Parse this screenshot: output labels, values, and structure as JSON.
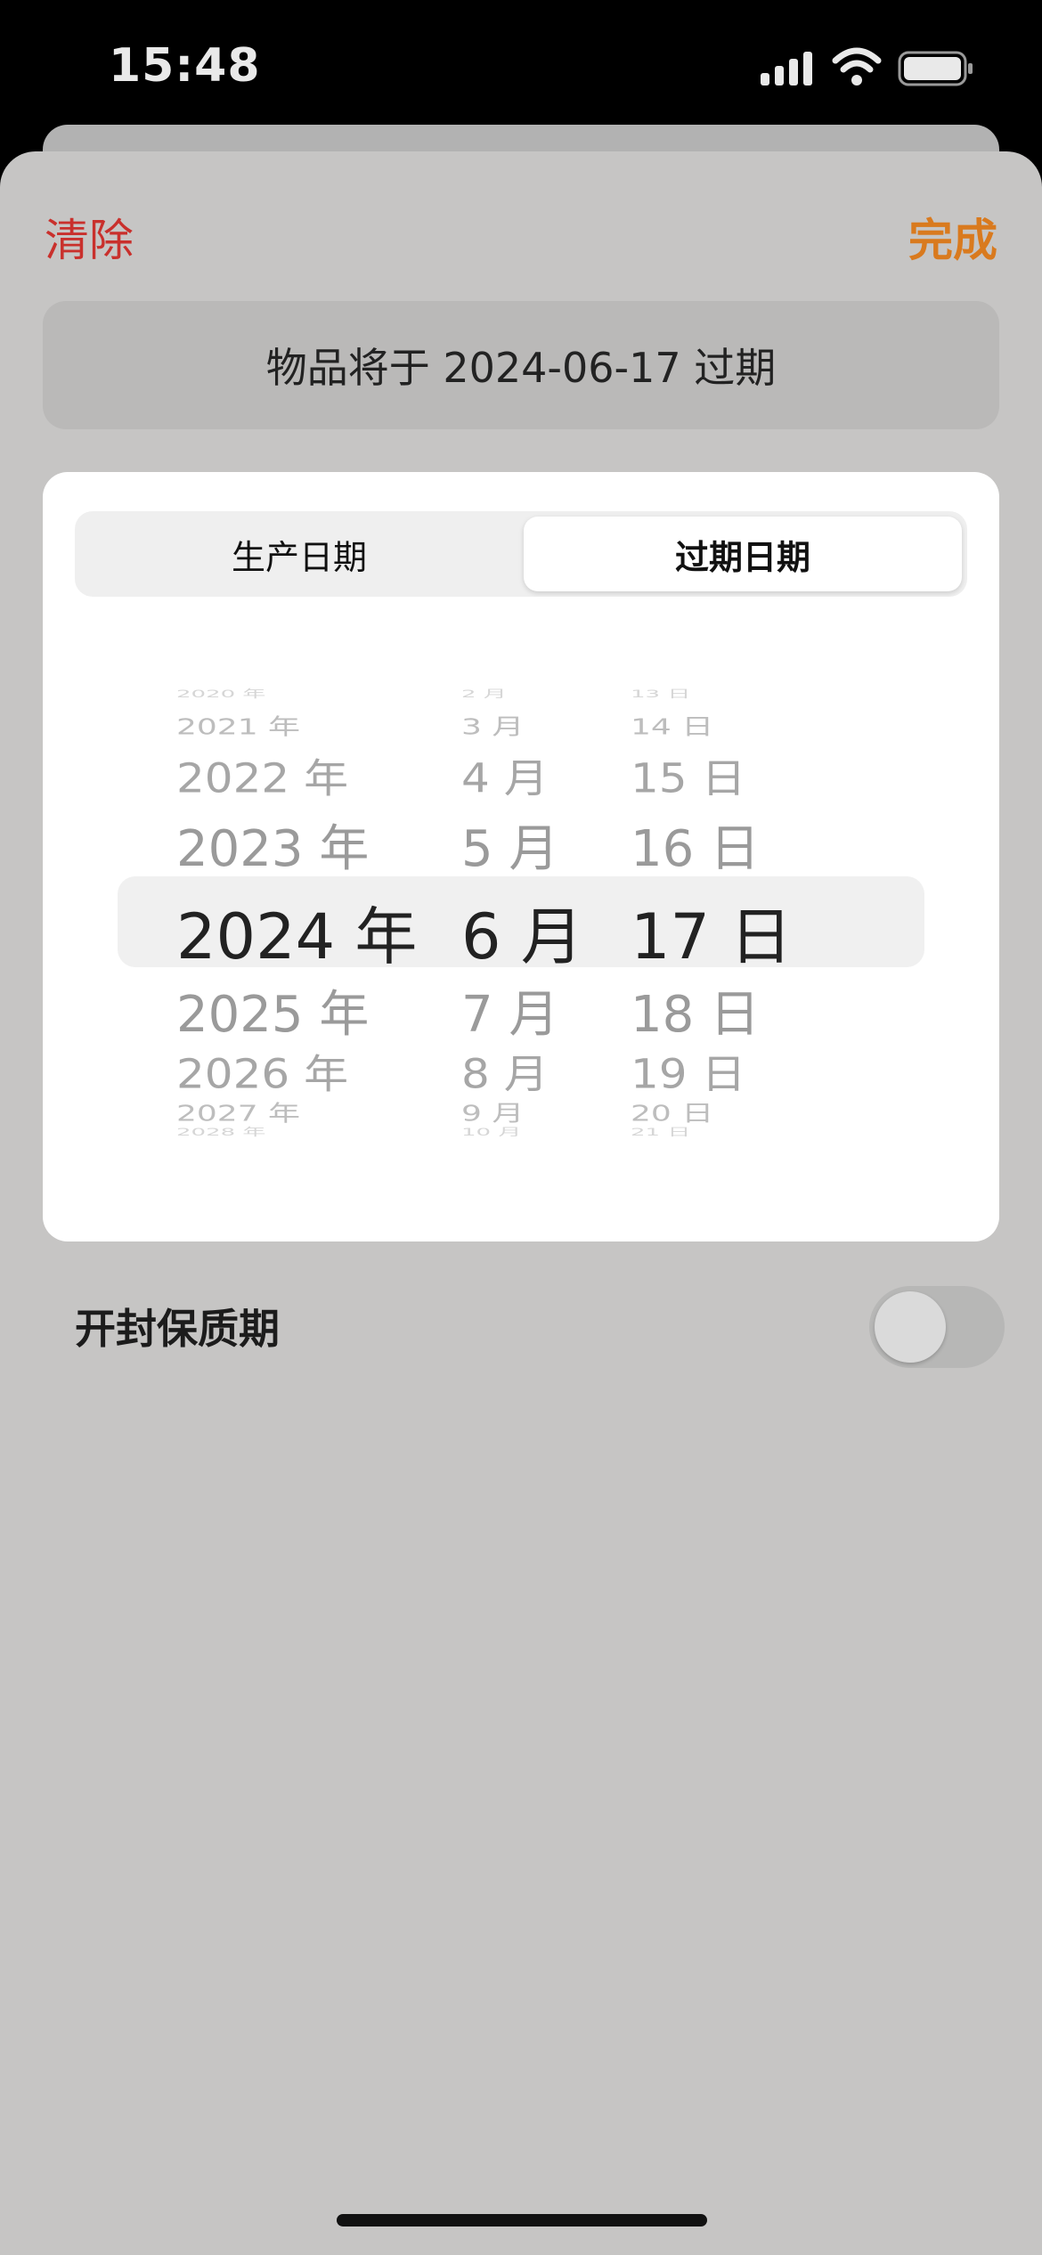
{
  "status_bar": {
    "time": "15:48",
    "icons": [
      "signal-icon",
      "wifi-icon",
      "battery-icon"
    ]
  },
  "header": {
    "clear_label": "清除",
    "done_label": "完成",
    "clear_color": "#c9302c",
    "done_color": "#d97a1e"
  },
  "summary": {
    "text": "物品将于 2024-06-17 过期"
  },
  "segmented": {
    "tabs": [
      {
        "label": "生产日期",
        "selected": false
      },
      {
        "label": "过期日期",
        "selected": true
      }
    ]
  },
  "picker": {
    "years": [
      "2020 年",
      "2021 年",
      "2022 年",
      "2023 年",
      "2024 年",
      "2025 年",
      "2026 年",
      "2027 年",
      "2028 年"
    ],
    "months": [
      "2 月",
      "3 月",
      "4 月",
      "5 月",
      "6 月",
      "7 月",
      "8 月",
      "9 月",
      "10 月"
    ],
    "days": [
      "13 日",
      "14 日",
      "15 日",
      "16 日",
      "17 日",
      "18 日",
      "19 日",
      "20 日",
      "21 日"
    ],
    "selected": {
      "year": "2024 年",
      "month": "6 月",
      "day": "17 日"
    }
  },
  "sealed_shelf_life": {
    "label": "开封保质期",
    "enabled": false
  }
}
